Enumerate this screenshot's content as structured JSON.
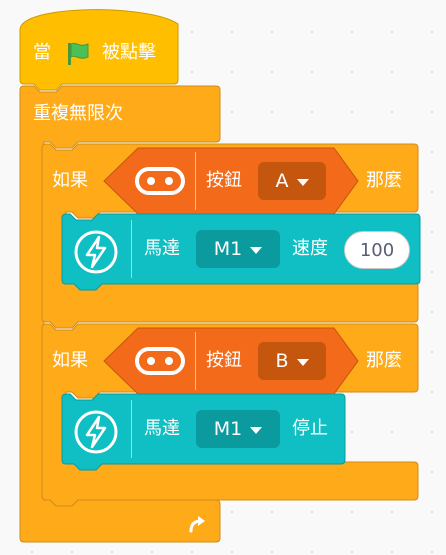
{
  "hat": {
    "prefix": "當",
    "suffix": "被點擊",
    "flag_icon": "green-flag-icon"
  },
  "forever": {
    "label": "重複無限次",
    "loop_icon": "loop-arrow-icon"
  },
  "if1": {
    "if_label": "如果",
    "then_label": "那麼",
    "sensor_icon": "microbit-icon",
    "button_label": "按鈕",
    "button_value": "A",
    "motor": {
      "icon": "lightning-icon",
      "label": "馬達",
      "motor_value": "M1",
      "speed_label": "速度",
      "speed_value": "100"
    }
  },
  "if2": {
    "if_label": "如果",
    "then_label": "那麼",
    "sensor_icon": "microbit-icon",
    "button_label": "按鈕",
    "button_value": "B",
    "motor": {
      "icon": "lightning-icon",
      "label": "馬達",
      "motor_value": "M1",
      "stop_label": "停止"
    }
  },
  "colors": {
    "events": "#ffbf00",
    "control": "#ffab19",
    "control_border": "#cf8b17",
    "sensor": "#f26a1a",
    "sensor_dark": "#c4560d",
    "motor": "#0fbfc3",
    "motor_dark": "#0b9a9d",
    "workspace": "#f9f9f9"
  }
}
